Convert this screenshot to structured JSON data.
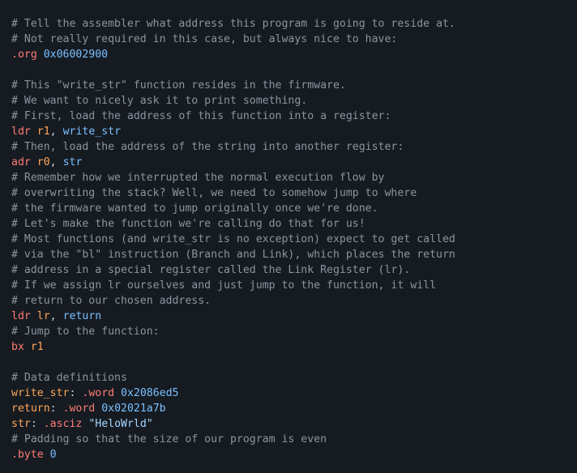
{
  "code": {
    "c1": "# Tell the assembler what address this program is going to reside at.",
    "c2": "# Not really required in this case, but always nice to have:",
    "d_org": ".org",
    "n_org": "0x06002900",
    "c3": "# This \"write_str\" function resides in the firmware.",
    "c4": "# We want to nicely ask it to print something.",
    "c5": "# First, load the address of this function into a register:",
    "m_ldr1": "ldr",
    "r_r1": "r1",
    "comma": ",",
    "id_ws": "write_str",
    "c6": "# Then, load the address of the string into another register:",
    "m_adr": "adr",
    "r_r0": "r0",
    "id_str": "str",
    "c7": "# Remember how we interrupted the normal execution flow by",
    "c8": "# overwriting the stack? Well, we need to somehow jump to where",
    "c9": "# the firmware wanted to jump originally once we're done.",
    "c10": "# Let's make the function we're calling do that for us!",
    "c11": "# Most functions (and write_str is no exception) expect to get called",
    "c12": "# via the \"bl\" instruction (Branch and Link), which places the return",
    "c13": "# address in a special register called the Link Register (lr).",
    "c14": "# If we assign lr ourselves and just jump to the function, it will",
    "c15": "# return to our chosen address.",
    "m_ldr2": "ldr",
    "r_lr": "lr",
    "id_ret": "return",
    "c16": "# Jump to the function:",
    "m_bx": "bx",
    "c17": "# Data definitions",
    "lbl_ws": "write_str",
    "colon": ":",
    "d_word": ".word",
    "n_ws": "0x2086ed5",
    "lbl_ret": "return",
    "n_ret": "0x02021a7b",
    "lbl_str": "str",
    "d_asciz": ".asciz",
    "s_hw": "\"HeloWrld\"",
    "c18": "# Padding so that the size of our program is even",
    "d_byte": ".byte",
    "n_zero": "0"
  }
}
